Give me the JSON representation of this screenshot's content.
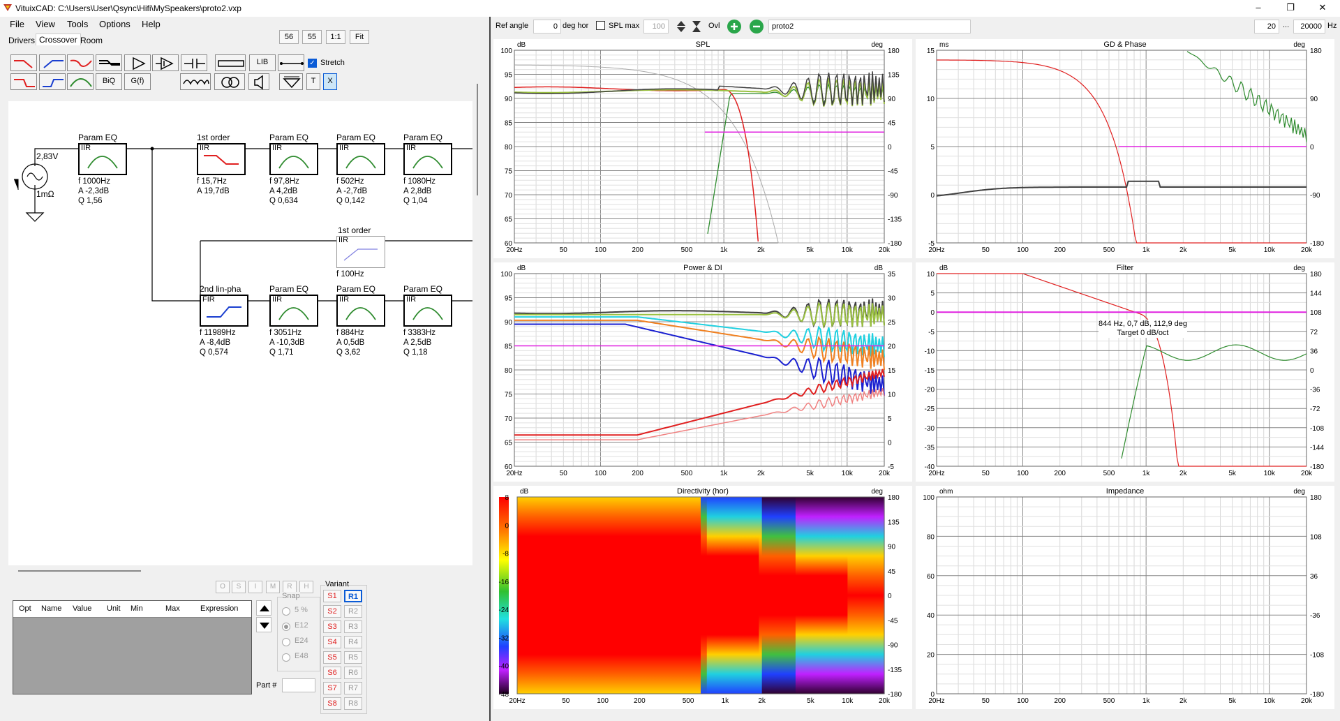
{
  "window": {
    "title": "VituixCAD: C:\\Users\\User\\Qsync\\Hifi\\MySpeakers\\proto2.vxp",
    "controls": [
      "–",
      "❐",
      "✕"
    ]
  },
  "menu": [
    "File",
    "View",
    "Tools",
    "Options",
    "Help"
  ],
  "tabs": [
    "Drivers",
    "Crossover",
    "Room"
  ],
  "zoom_buttons": [
    "56",
    "55",
    "1:1",
    "Fit"
  ],
  "toolbar": {
    "lib_label": "LIB",
    "biq_label": "BiQ",
    "gf_label": "G(f)",
    "t_label": "T",
    "x_label": "X",
    "stretch_label": "Stretch"
  },
  "schematic": {
    "source_voltage": "2,83V",
    "source_impedance": "1mΩ",
    "blocks": [
      {
        "title": "Param EQ",
        "kind": "IIR",
        "lines": [
          "f   1000Hz",
          "A  -2,3dB",
          "Q  1,56"
        ]
      },
      {
        "title": "1st order",
        "kind": "IIR",
        "lines": [
          "f   15,7Hz",
          "A  19,7dB"
        ]
      },
      {
        "title": "Param EQ",
        "kind": "IIR",
        "lines": [
          "f   97,8Hz",
          "A  4,2dB",
          "Q  0,634"
        ]
      },
      {
        "title": "Param EQ",
        "kind": "IIR",
        "lines": [
          "f   502Hz",
          "A  -2,7dB",
          "Q  0,142"
        ]
      },
      {
        "title": "Param EQ",
        "kind": "IIR",
        "lines": [
          "f   1080Hz",
          "A  2,8dB",
          "Q  1,04"
        ]
      },
      {
        "title": "1st order",
        "kind": "IIR",
        "lines": [
          "f   100Hz"
        ]
      },
      {
        "title": "2nd lin-pha",
        "kind": "FIR",
        "lines": [
          "f   11989Hz",
          "A  -8,4dB",
          "Q  0,574"
        ]
      },
      {
        "title": "Param EQ",
        "kind": "IIR",
        "lines": [
          "f   3051Hz",
          "A  -10,3dB",
          "Q  1,71"
        ]
      },
      {
        "title": "Param EQ",
        "kind": "IIR",
        "lines": [
          "f   884Hz",
          "A  0,5dB",
          "Q  3,62"
        ]
      },
      {
        "title": "Param EQ",
        "kind": "IIR",
        "lines": [
          "f   3383Hz",
          "A  2,5dB",
          "Q  1,18"
        ]
      }
    ]
  },
  "opt_buttons": [
    "O",
    "S",
    "I",
    "M",
    "R",
    "H"
  ],
  "param_table": {
    "columns": [
      "Opt",
      "Name",
      "Value",
      "Unit",
      "Min",
      "Max",
      "Expression"
    ]
  },
  "snap": {
    "label": "Snap",
    "options": [
      "5 %",
      "E12",
      "E24",
      "E48"
    ],
    "selected": "E12"
  },
  "part_label": "Part #",
  "variant": {
    "label": "Variant",
    "s": [
      "S1",
      "S2",
      "S3",
      "S4",
      "S5",
      "S6",
      "S7",
      "S8"
    ],
    "r": [
      "R1",
      "R2",
      "R3",
      "R4",
      "R5",
      "R6",
      "R7",
      "R8"
    ],
    "selected_s": "S1",
    "selected_r": "R1"
  },
  "graph_toolbar": {
    "ref_angle_label": "Ref angle",
    "ref_angle_value": "0",
    "deg_hor_label": "deg hor",
    "spl_max_label": "SPL max",
    "spl_max_value": "100",
    "ovl_label": "Ovl",
    "overlay_name": "proto2",
    "freq_min": "20",
    "freq_sep": "...",
    "freq_max": "20000",
    "hz_label": "Hz"
  },
  "freq_ticks": [
    "20Hz",
    "50",
    "100",
    "200",
    "500",
    "1k",
    "2k",
    "5k",
    "10k",
    "20k"
  ],
  "graphs": {
    "spl": {
      "title": "SPL",
      "left_unit": "dB",
      "right_unit": "deg",
      "left_ticks": [
        "100",
        "95",
        "90",
        "85",
        "80",
        "75",
        "70",
        "65",
        "60"
      ],
      "right_ticks": [
        "180",
        "135",
        "90",
        "45",
        "0",
        "-45",
        "-90",
        "-135",
        "-180"
      ]
    },
    "gd": {
      "title": "GD & Phase",
      "left_unit": "ms",
      "right_unit": "deg",
      "left_ticks": [
        "15",
        "10",
        "5",
        "0",
        "-5"
      ],
      "right_ticks": [
        "180",
        "90",
        "0",
        "-90",
        "-180"
      ]
    },
    "power": {
      "title": "Power & DI",
      "left_unit": "dB",
      "right_unit": "dB",
      "left_ticks": [
        "100",
        "95",
        "90",
        "85",
        "80",
        "75",
        "70",
        "65",
        "60"
      ],
      "right_ticks": [
        "35",
        "30",
        "25",
        "20",
        "15",
        "10",
        "5",
        "0",
        "-5"
      ]
    },
    "filter": {
      "title": "Filter",
      "left_unit": "dB",
      "right_unit": "deg",
      "left_ticks": [
        "10",
        "5",
        "0",
        "-5",
        "-10",
        "-15",
        "-20",
        "-25",
        "-30",
        "-35",
        "-40"
      ],
      "right_ticks": [
        "180",
        "144",
        "108",
        "72",
        "36",
        "0",
        "-36",
        "-72",
        "-108",
        "-144",
        "-180"
      ],
      "tooltip_line1": "844 Hz, 0,7 dB, 112,9 deg",
      "tooltip_line2": "Target 0 dB/oct"
    },
    "directivity": {
      "title": "Directivity (hor)",
      "left_unit": "dB",
      "right_unit": "deg",
      "scale_ticks": [
        "8",
        "0",
        "-8",
        "-16",
        "-24",
        "-32",
        "-40",
        "-48"
      ],
      "right_ticks": [
        "180",
        "135",
        "90",
        "45",
        "0",
        "-45",
        "-90",
        "-135",
        "-180"
      ]
    },
    "impedance": {
      "title": "Impedance",
      "left_unit": "ohm",
      "right_unit": "deg",
      "left_ticks": [
        "100",
        "80",
        "60",
        "40",
        "20",
        "0"
      ],
      "right_ticks": [
        "180",
        "108",
        "36",
        "-36",
        "-108",
        "-180"
      ]
    }
  },
  "colors": {
    "accent_blue": "#0a5bd6",
    "woofer_green": "#2e8b2e",
    "tweeter_red": "#e02020",
    "target_magenta": "#e020e0",
    "sum_gray": "#404040"
  }
}
